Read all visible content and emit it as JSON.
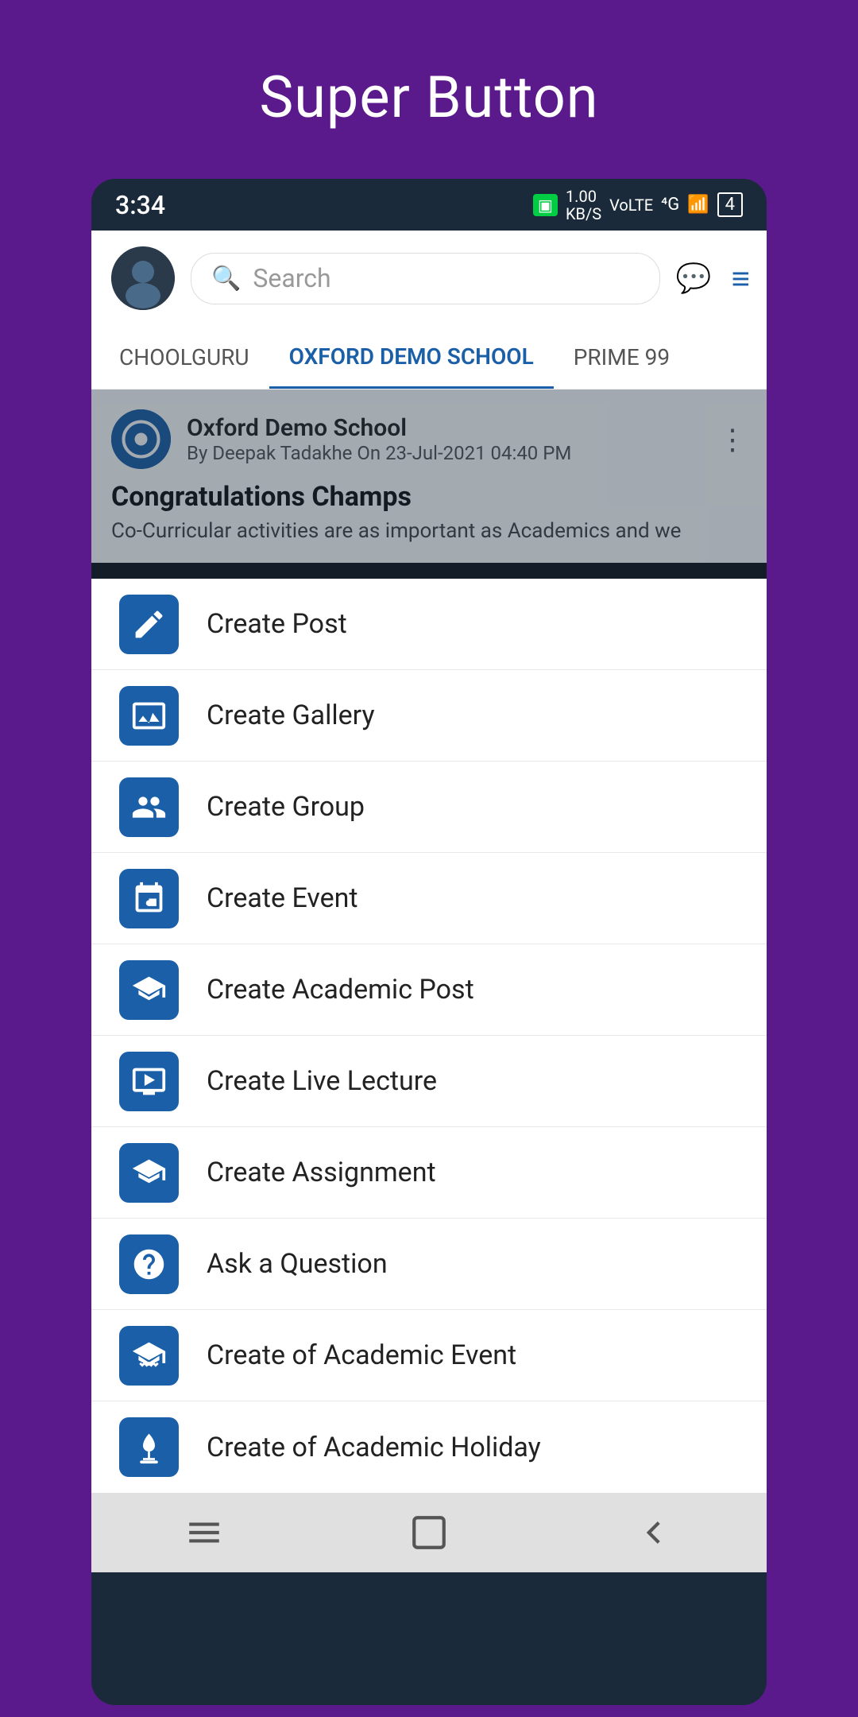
{
  "page": {
    "title": "Super Button"
  },
  "statusBar": {
    "time": "3:34",
    "data": "1.00\nKB/S",
    "network": "4G",
    "battery": "4"
  },
  "header": {
    "searchPlaceholder": "Search",
    "searchText": "Search"
  },
  "tabs": [
    {
      "label": "CHOOLGURU",
      "active": false
    },
    {
      "label": "OXFORD DEMO SCHOOL",
      "active": true
    },
    {
      "label": "PRIME 99",
      "active": false
    }
  ],
  "post": {
    "school": "Oxford Demo School",
    "meta": "By Deepak Tadakhe On 23-Jul-2021 04:40 PM",
    "title": "Congratulations Champs",
    "body": "Co-Curricular activities are as important as Academics and we"
  },
  "menuItems": [
    {
      "id": "create-post",
      "label": "Create Post",
      "icon": "post"
    },
    {
      "id": "create-gallery",
      "label": "Create Gallery",
      "icon": "gallery"
    },
    {
      "id": "create-group",
      "label": "Create Group",
      "icon": "group"
    },
    {
      "id": "create-event",
      "label": "Create Event",
      "icon": "event"
    },
    {
      "id": "create-academic-post",
      "label": "Create Academic Post",
      "icon": "academic-post"
    },
    {
      "id": "create-live-lecture",
      "label": "Create Live Lecture",
      "icon": "live-lecture"
    },
    {
      "id": "create-assignment",
      "label": "Create Assignment",
      "icon": "assignment"
    },
    {
      "id": "ask-question",
      "label": "Ask a Question",
      "icon": "question"
    },
    {
      "id": "create-academic-event",
      "label": "Create of Academic Event",
      "icon": "academic-event"
    },
    {
      "id": "create-academic-holiday",
      "label": "Create of Academic Holiday",
      "icon": "academic-holiday"
    }
  ],
  "bottomNav": {
    "menu": "≡",
    "home": "□",
    "back": "◁"
  }
}
